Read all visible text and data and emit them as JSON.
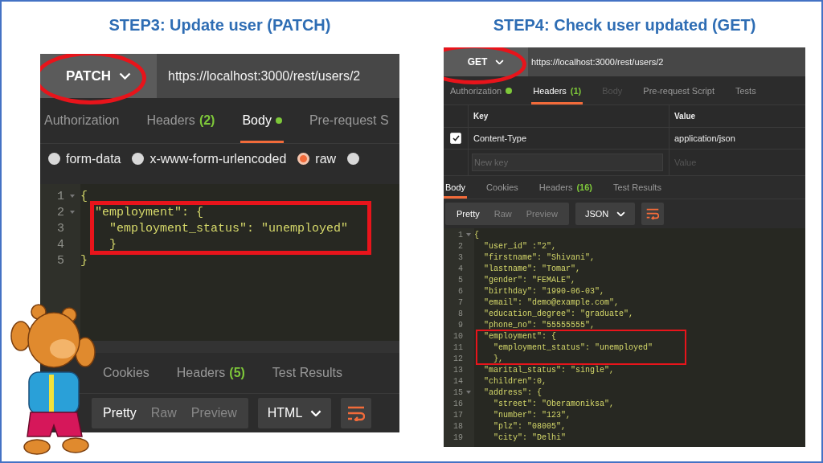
{
  "steps": [
    {
      "title": "STEP3: Update user (PATCH)",
      "request": {
        "method": "PATCH",
        "url": "https://localhost:3000/rest/users/2",
        "method_circled": true
      },
      "request_tabs": [
        {
          "label": "Authorization",
          "dot": false,
          "selected": false,
          "disabled": false
        },
        {
          "label": "Headers",
          "count": "(2)",
          "dot": false,
          "selected": false,
          "disabled": false
        },
        {
          "label": "Body",
          "dot": true,
          "selected": true,
          "disabled": false
        },
        {
          "label": "Pre-request S",
          "dot": false,
          "selected": false,
          "disabled": false
        }
      ],
      "body_types": [
        {
          "label": "form-data",
          "selected": false
        },
        {
          "label": "x-www-form-urlencoded",
          "selected": false
        },
        {
          "label": "raw",
          "selected": true
        },
        {
          "selected": false
        }
      ],
      "request_editor": [
        {
          "number": "1",
          "text": "{",
          "foldable": true,
          "highlighted": false
        },
        {
          "number": "2",
          "text": "  \"employment\": {",
          "foldable": true,
          "highlighted": true
        },
        {
          "number": "3",
          "text": "    \"employment_status\": \"unemployed\"",
          "foldable": false,
          "highlighted": true
        },
        {
          "number": "4",
          "text": "    }",
          "foldable": false,
          "highlighted": true
        },
        {
          "number": "5",
          "text": "}",
          "foldable": false,
          "highlighted": false
        }
      ],
      "response_tabs": [
        {
          "label": "Cookies",
          "selected": false
        },
        {
          "label": "Headers",
          "count": "(5)",
          "selected": false
        },
        {
          "label": "Test Results",
          "selected": false
        }
      ],
      "response_toolbar": {
        "view_modes": [
          {
            "label": "Pretty",
            "selected": true
          },
          {
            "label": "Raw",
            "selected": false
          },
          {
            "label": "Preview",
            "selected": false
          }
        ],
        "format": "HTML"
      }
    },
    {
      "title": "STEP4: Check user updated (GET)",
      "request": {
        "method": "GET",
        "url": "https://localhost:3000/rest/users/2",
        "method_circled": true
      },
      "request_tabs": [
        {
          "label": "Authorization",
          "dot": true,
          "selected": false,
          "disabled": false
        },
        {
          "label": "Headers",
          "count": "(1)",
          "dot": false,
          "selected": true,
          "disabled": false
        },
        {
          "label": "Body",
          "dot": false,
          "selected": false,
          "disabled": true
        },
        {
          "label": "Pre-request Script",
          "dot": false,
          "selected": false,
          "disabled": false
        },
        {
          "label": "Tests",
          "dot": false,
          "selected": false,
          "disabled": false
        }
      ],
      "headers_table": {
        "columns": [
          "Key",
          "Value"
        ],
        "rows": [
          {
            "checked": true,
            "key": "Content-Type",
            "value": "application/json"
          }
        ],
        "new_row": {
          "key_placeholder": "New key",
          "value_placeholder": "Value"
        }
      },
      "response_tabs": [
        {
          "label": "Body",
          "selected": true
        },
        {
          "label": "Cookies",
          "selected": false
        },
        {
          "label": "Headers",
          "count": "(16)",
          "selected": false
        },
        {
          "label": "Test Results",
          "selected": false
        }
      ],
      "response_toolbar": {
        "view_modes": [
          {
            "label": "Pretty",
            "selected": true
          },
          {
            "label": "Raw",
            "selected": false
          },
          {
            "label": "Preview",
            "selected": false
          }
        ],
        "format": "JSON"
      },
      "response_body": [
        {
          "number": "1",
          "text": "{",
          "foldable": true,
          "highlighted": false
        },
        {
          "number": "2",
          "text": "  \"user_id\" :\"2\",",
          "foldable": false,
          "highlighted": false
        },
        {
          "number": "3",
          "text": "  \"firstname\": \"Shivani\",",
          "foldable": false,
          "highlighted": false
        },
        {
          "number": "4",
          "text": "  \"lastname\": \"Tomar\",",
          "foldable": false,
          "highlighted": false
        },
        {
          "number": "5",
          "text": "  \"gender\": \"FEMALE\",",
          "foldable": false,
          "highlighted": false
        },
        {
          "number": "6",
          "text": "  \"birthday\": \"1990-06-03\",",
          "foldable": false,
          "highlighted": false
        },
        {
          "number": "7",
          "text": "  \"email\": \"demo@example.com\",",
          "foldable": false,
          "highlighted": false
        },
        {
          "number": "8",
          "text": "  \"education_degree\": \"graduate\",",
          "foldable": false,
          "highlighted": false
        },
        {
          "number": "9",
          "text": "  \"phone_no\": \"55555555\",",
          "foldable": false,
          "highlighted": false
        },
        {
          "number": "10",
          "text": "  \"employment\": {",
          "foldable": false,
          "highlighted": true
        },
        {
          "number": "11",
          "text": "    \"employment_status\": \"unemployed\"",
          "foldable": false,
          "highlighted": true
        },
        {
          "number": "12",
          "text": "    },",
          "foldable": false,
          "highlighted": true
        },
        {
          "number": "13",
          "text": "  \"marital_status\": \"single\",",
          "foldable": false,
          "highlighted": false
        },
        {
          "number": "14",
          "text": "  \"children\":0,",
          "foldable": false,
          "highlighted": false
        },
        {
          "number": "15",
          "text": "  \"address\": {",
          "foldable": true,
          "highlighted": false
        },
        {
          "number": "16",
          "text": "    \"street\": \"Oberamoniksa\",",
          "foldable": false,
          "highlighted": false
        },
        {
          "number": "17",
          "text": "    \"number\": \"123\",",
          "foldable": false,
          "highlighted": false
        },
        {
          "number": "18",
          "text": "    \"plz\": \"08005\",",
          "foldable": false,
          "highlighted": false
        },
        {
          "number": "19",
          "text": "    \"city\": \"Delhi\"",
          "foldable": false,
          "highlighted": false
        }
      ]
    }
  ]
}
